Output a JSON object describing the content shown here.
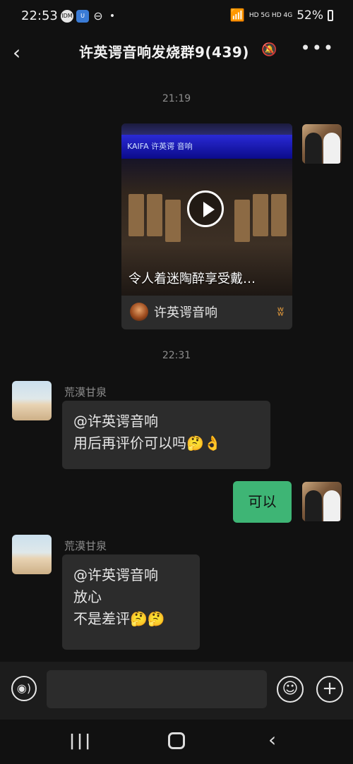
{
  "status_bar": {
    "time": "22:53",
    "left_icons": [
      "IDM",
      "U",
      "⊖",
      "•"
    ],
    "right_text": "HD 5G HD 4G",
    "battery": "52%"
  },
  "header": {
    "back_icon": "‹",
    "title": "许英谔音响发烧群9(439)",
    "mute_icon": "🔕",
    "more_icon": "•••"
  },
  "messages": {
    "time1": "21:19",
    "video": {
      "banner_text": "KAIFA 许英谔 音响",
      "caption": "令人着迷陶醉享受戴…",
      "source_name": "许英谔音响"
    },
    "time2": "22:31",
    "msg1": {
      "sender": "荒漠甘泉",
      "line1": "@许英谔音响",
      "line2": "用后再评价可以吗🤔👌"
    },
    "reply": "可以",
    "msg2": {
      "sender": "荒漠甘泉",
      "line1": "@许英谔音响",
      "line2": "放心",
      "line3": "不是差评🤔🤔"
    }
  },
  "input_bar": {
    "voice_icon": "◉)",
    "input_value": "",
    "emoji_icon": "☺",
    "plus_icon": "+"
  },
  "nav_bar": {
    "recent_icon": "|||",
    "back_icon": "‹"
  },
  "colors": {
    "background": "#111111",
    "bubble": "#2c2c2c",
    "self_bubble": "#3eb575",
    "input_bar": "#1c1c1c"
  }
}
